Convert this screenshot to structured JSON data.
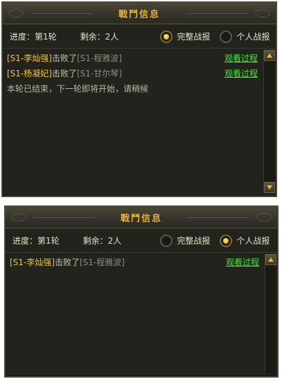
{
  "panels": [
    {
      "title": "戰鬥信息",
      "progress_label": "进度：",
      "progress_value": "第1轮",
      "remaining_label": "剩余：",
      "remaining_value": "2人",
      "radio_full": {
        "label": "完整战报",
        "selected": true
      },
      "radio_personal": {
        "label": "个人战报",
        "selected": false
      },
      "rows": [
        {
          "name": "[S1-李灿强]",
          "action": "击败了",
          "opponent": "[S1-程雅波]",
          "link": "观看过程"
        },
        {
          "name": "[S1-杨凝妃]",
          "action": "击败了",
          "opponent": "[S1-甘尔琴]",
          "link": "观看过程"
        }
      ],
      "note": "本轮已结束，下一轮即将开始，请稍候"
    },
    {
      "title": "戰鬥信息",
      "progress_label": "进度：",
      "progress_value": "第1轮",
      "remaining_label": "剩余：",
      "remaining_value": "2人",
      "radio_full": {
        "label": "完整战报",
        "selected": false
      },
      "radio_personal": {
        "label": "个人战报",
        "selected": true
      },
      "rows": [
        {
          "name": "[S1-李灿强]",
          "action": "击败了",
          "opponent": "[S1-程雅波]",
          "link": "观看过程"
        }
      ]
    }
  ],
  "colors": {
    "gold": "#e8b93d",
    "player_name": "#f2c23a",
    "link_green": "#4be33a",
    "panel_bg": "#23231d"
  }
}
